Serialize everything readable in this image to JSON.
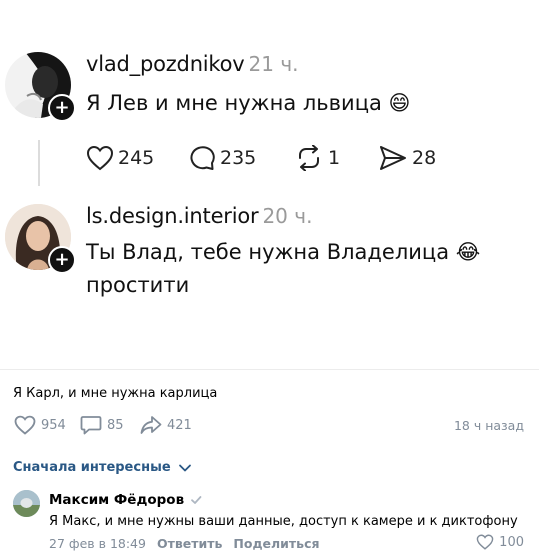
{
  "thread": {
    "post1": {
      "username": "vlad_pozdnikov",
      "time": "21 ч.",
      "text": "Я Лев и мне нужна львица",
      "emoji": "😄",
      "likes": "245",
      "comments": "235",
      "reposts": "1",
      "shares": "28"
    },
    "post2": {
      "username": "ls.design.interior",
      "time": "20 ч.",
      "text_line1": "Ты Влад, тебе нужна Владелица",
      "emoji": "😂",
      "text_line2": "простити"
    }
  },
  "vk_post": {
    "text": "Я Карл, и мне нужна карлица",
    "likes": "954",
    "comments": "85",
    "shares": "421",
    "time": "18 ч назад"
  },
  "comments_section": {
    "sort_label": "Сначала интересные",
    "comment": {
      "author": "Максим Фёдоров",
      "text": "Я Макс, и мне нужны ваши данные, доступ к камере и к диктофону",
      "date": "27 фев в 18:49",
      "reply": "Ответить",
      "share": "Поделиться",
      "likes": "100"
    }
  },
  "colors": {
    "vk_link": "#2a5885",
    "vk_secondary": "#818c99",
    "threads_time": "#9a9a9a"
  }
}
